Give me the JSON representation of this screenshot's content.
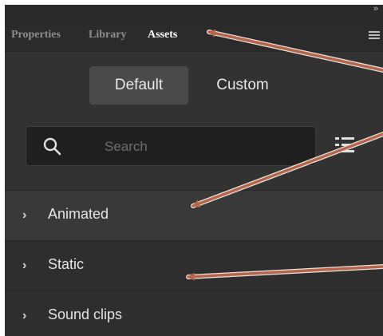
{
  "collapse_icon": "double-chevron-right-icon",
  "tabs": [
    {
      "label": "Properties"
    },
    {
      "label": "Library"
    },
    {
      "label": "Assets"
    }
  ],
  "active_tab": "Assets",
  "toggle": {
    "default_label": "Default",
    "custom_label": "Custom",
    "selected": "Default"
  },
  "search": {
    "placeholder": "Search",
    "value": ""
  },
  "categories": [
    {
      "label": "Animated"
    },
    {
      "label": "Static"
    },
    {
      "label": "Sound clips"
    }
  ],
  "colors": {
    "annotation_arrow": "#b5654a",
    "panel_bg": "#323232"
  }
}
